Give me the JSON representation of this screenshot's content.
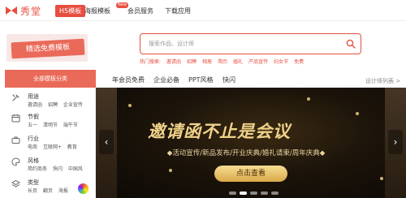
{
  "topnav": {
    "logo_text": "秀堂",
    "h5_tab": "H5模板",
    "items": [
      "海报模板",
      "会员服务",
      "下载应用"
    ],
    "new_badge": "New"
  },
  "banner": {
    "label": "精选免费模板"
  },
  "search": {
    "placeholder": "搜索作品、设计师",
    "hot_label": "热门搜索:",
    "hot_terms": [
      "邀请函",
      "招聘",
      "相册",
      "简历",
      "婚礼",
      "产品宣传",
      "妇女节",
      "免费"
    ]
  },
  "sidebar": {
    "header": "全部模板分类",
    "categories": [
      {
        "title": "用途",
        "subs": [
          "邀请函",
          "招聘",
          "企业宣传"
        ],
        "icon": "tools-icon"
      },
      {
        "title": "节假",
        "subs": [
          "五一",
          "清明节",
          "端午节"
        ],
        "icon": "calendar-icon"
      },
      {
        "title": "行业",
        "subs": [
          "电商",
          "互联网+",
          "教育"
        ],
        "icon": "briefcase-icon"
      },
      {
        "title": "风格",
        "subs": [
          "简约商务",
          "快闪",
          "中国风"
        ],
        "icon": "palette-icon"
      },
      {
        "title": "类型",
        "subs": [
          "长页",
          "翻页",
          "海报"
        ],
        "icon": "layers-icon"
      }
    ]
  },
  "tabs": [
    "年会员免费",
    "企业必备",
    "PPT风格",
    "快闪"
  ],
  "tab_list_link": "设计师列表 >",
  "hero": {
    "title": "邀请函不止是会议",
    "subtitle": "◆活动宣传/新品发布/开业庆典/婚礼请柬/周年庆典◆",
    "button": "点击查看",
    "slide_count": 5,
    "active_slide": 1
  },
  "colors": {
    "accent": "#e84e40",
    "hero_gold": "#f0d28a"
  }
}
